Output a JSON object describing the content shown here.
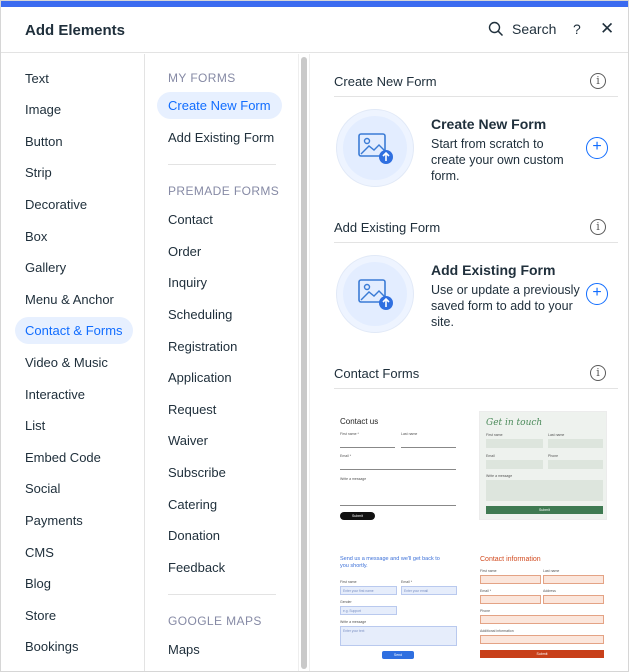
{
  "header": {
    "title": "Add Elements",
    "search_label": "Search",
    "help_label": "?",
    "close_label": "✕"
  },
  "categories": [
    "Text",
    "Image",
    "Button",
    "Strip",
    "Decorative",
    "Box",
    "Gallery",
    "Menu & Anchor",
    "Contact & Forms",
    "Video & Music",
    "Interactive",
    "List",
    "Embed Code",
    "Social",
    "Payments",
    "CMS",
    "Blog",
    "Store",
    "Bookings"
  ],
  "active_category": "Contact & Forms",
  "forms_nav": {
    "my_forms_header": "MY FORMS",
    "my_forms": [
      "Create New Form",
      "Add Existing Form"
    ],
    "premade_header": "PREMADE FORMS",
    "premade": [
      "Contact",
      "Order",
      "Inquiry",
      "Scheduling",
      "Registration",
      "Application",
      "Request",
      "Waiver",
      "Subscribe",
      "Catering",
      "Donation",
      "Feedback"
    ],
    "google_maps_header": "GOOGLE MAPS",
    "google_maps": [
      "Maps"
    ]
  },
  "sections": {
    "create": {
      "header": "Create New Form",
      "title": "Create New Form",
      "desc": "Start from scratch to create your own custom form."
    },
    "existing": {
      "header": "Add Existing Form",
      "title": "Add Existing Form",
      "desc": "Use or update a previously saved form to add to your site."
    },
    "contact": {
      "header": "Contact Forms"
    }
  },
  "templates": {
    "t1": {
      "title": "Contact us",
      "first": "First name *",
      "last": "Last name",
      "email": "Email *",
      "message": "Write a message",
      "submit": "Submit"
    },
    "t2": {
      "title": "Get in touch",
      "first": "First name",
      "last": "Last name",
      "email": "Email",
      "phone": "Phone",
      "message": "Write a message",
      "submit": "Submit"
    },
    "t3": {
      "title": "Send us a message and we'll get back to you shortly.",
      "first": "First name",
      "email": "Email *",
      "first_ph": "Enter your first name",
      "email_ph": "Enter your email",
      "gender": "Gender",
      "gender_ph": "e.g. Support",
      "message": "Write a message",
      "message_ph": "Enter your text",
      "submit": "Send"
    },
    "t4": {
      "title": "Contact information",
      "first": "First name",
      "last": "Last name",
      "email": "Email *",
      "address": "Address",
      "phone": "Phone",
      "info": "Additional information",
      "submit": "Submit"
    }
  },
  "colors": {
    "accent": "#116dff",
    "active_bg": "#e7f0ff",
    "top_bar": "#3b6bf0"
  }
}
